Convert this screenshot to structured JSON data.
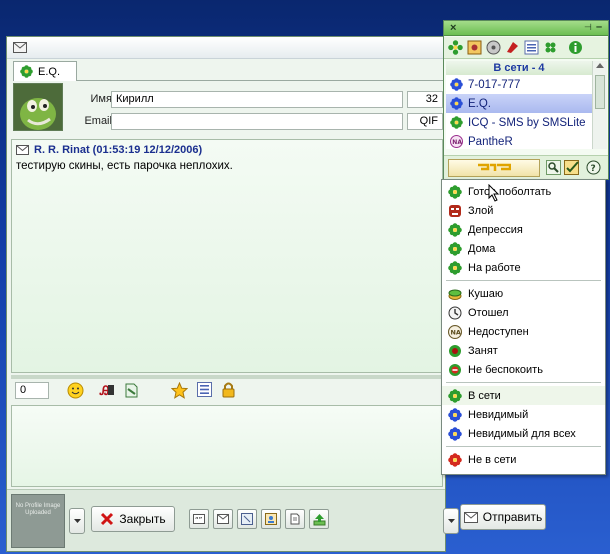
{
  "chat": {
    "tab_label": "E.Q.",
    "name_label": "Имя:",
    "name_value": "Кирилл",
    "email_label": "Email:",
    "email_value": "",
    "uin_partial": "32",
    "client_partial": "QIF",
    "message": {
      "header": "R. R. Rinat (01:53:19 12/12/2006)",
      "text": "тестирую скины, есть парочка неплохих."
    },
    "char_count": "0",
    "avatar_text": "No Profile Image Uploaded",
    "close_button": "Закрыть",
    "send_button": "Отправить"
  },
  "contact_list": {
    "group_header": "В сети - 4",
    "contacts": [
      {
        "name": "7-017-777",
        "icon": "flower-blue-icon"
      },
      {
        "name": "E.Q.",
        "icon": "flower-blue-icon",
        "selected": true
      },
      {
        "name": "ICQ - SMS by SMSLite",
        "icon": "flower-green-icon"
      },
      {
        "name": "PantheR",
        "icon": "na-status-icon"
      }
    ]
  },
  "status_menu": {
    "items": [
      {
        "label": "Готов поболтать",
        "icon": "flower-green-icon"
      },
      {
        "label": "Злой",
        "icon": "angry-face-icon"
      },
      {
        "label": "Депрессия",
        "icon": "flower-green-icon"
      },
      {
        "label": "Дома",
        "icon": "flower-green-icon"
      },
      {
        "label": "На работе",
        "icon": "flower-green-icon"
      },
      {
        "label": "Кушаю",
        "icon": "food-icon"
      },
      {
        "label": "Отошел",
        "icon": "away-icon"
      },
      {
        "label": "Недоступен",
        "icon": "na-status-icon"
      },
      {
        "label": "Занят",
        "icon": "busy-icon"
      },
      {
        "label": "Не беспокоить",
        "icon": "dnd-icon"
      },
      {
        "label": "В сети",
        "icon": "flower-green-icon"
      },
      {
        "label": "Невидимый",
        "icon": "flower-blue-icon"
      },
      {
        "label": "Невидимый для всех",
        "icon": "flower-blue-icon"
      },
      {
        "label": "Не в сети",
        "icon": "flower-red-icon"
      }
    ]
  },
  "colors": {
    "desktop": "#123da8",
    "online_green": "#2e9d2e",
    "selection": "#aab9ef",
    "link_blue": "#1b2f8f"
  }
}
